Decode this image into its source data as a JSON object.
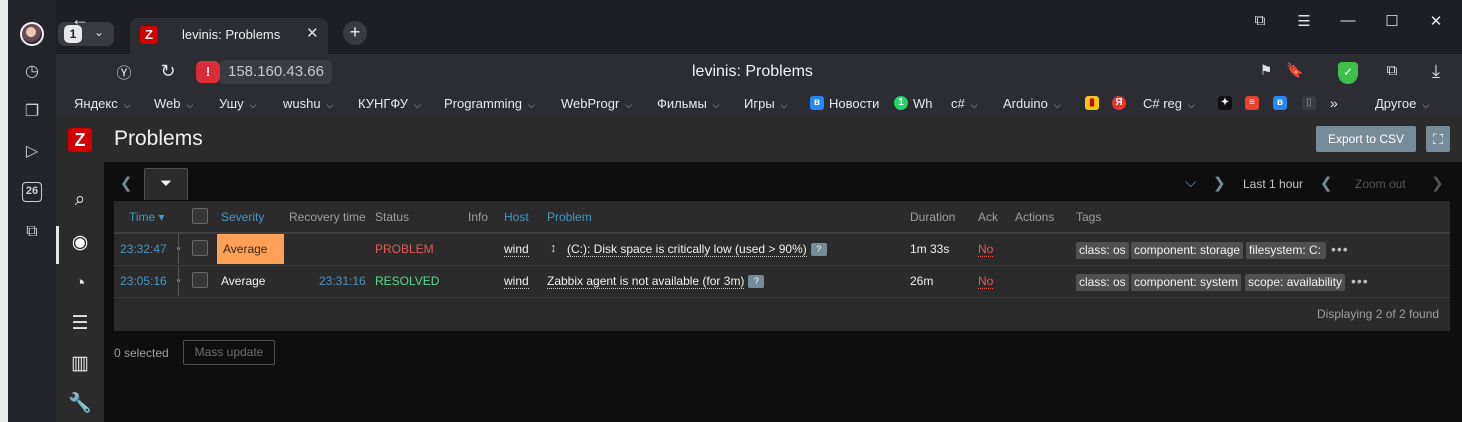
{
  "browser": {
    "tab_count": "1",
    "tab_title": "levinis: Problems",
    "url": "158.160.43.66",
    "page_title": "levinis: Problems",
    "bookmarks": [
      {
        "label": "Яндекс"
      },
      {
        "label": "Web"
      },
      {
        "label": "Ушу"
      },
      {
        "label": "wushu"
      },
      {
        "label": "КУНГФУ"
      },
      {
        "label": "Programming"
      },
      {
        "label": "WebProgr"
      },
      {
        "label": "Фильмы"
      },
      {
        "label": "Игры"
      },
      {
        "label": "Новости"
      },
      {
        "label": "Wh"
      },
      {
        "label": "c#"
      },
      {
        "label": "Arduino"
      },
      {
        "label": "C# reg"
      },
      {
        "label": "Другое"
      }
    ],
    "side_badge": "26"
  },
  "page": {
    "title": "Problems",
    "export_label": "Export to CSV",
    "time_range": "Last 1 hour",
    "zoom_out": "Zoom out"
  },
  "table": {
    "columns": [
      "Time ▾",
      "Severity",
      "Recovery time",
      "Status",
      "Info",
      "Host",
      "Problem",
      "Duration",
      "Ack",
      "Actions",
      "Tags"
    ],
    "rows": [
      {
        "time": "23:32:47",
        "severity": "Average",
        "recovery_time": "",
        "status": "PROBLEM",
        "host": "wind",
        "problem": "(C:): Disk space is critically low (used > 90%)",
        "duration": "1m 33s",
        "ack": "No",
        "tags": [
          "class: os",
          "component: storage",
          "filesystem: C:"
        ]
      },
      {
        "time": "23:05:16",
        "severity": "Average",
        "recovery_time": "23:31:16",
        "status": "RESOLVED",
        "host": "wind",
        "problem": "Zabbix agent is not available (for 3m)",
        "duration": "26m",
        "ack": "No",
        "tags": [
          "class: os",
          "component: system",
          "scope: availability"
        ]
      }
    ],
    "footer": "Displaying 2 of 2 found"
  },
  "bottom": {
    "selected": "0 selected",
    "mass_update": "Mass update"
  },
  "colors": {
    "severity_average": "#ffa059",
    "problem": "#e45959",
    "resolved": "#59db8f",
    "link": "#4796c4"
  }
}
